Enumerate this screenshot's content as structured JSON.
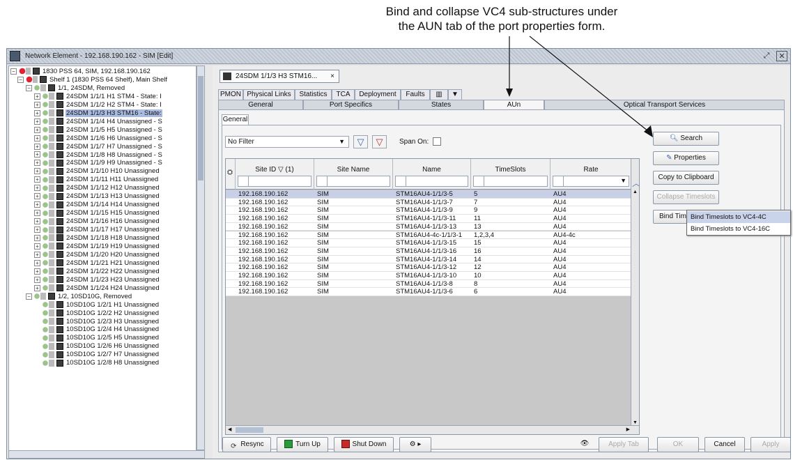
{
  "annotation": {
    "line1": "Bind and collapse VC4 sub-structures under",
    "line2": "the AUN tab of the port properties form."
  },
  "window": {
    "title": "Network Element - 192.168.190.162 - SIM [Edit]"
  },
  "tree": {
    "root": "1830 PSS 64, SIM, 192.168.190.162",
    "shelf": "Shelf 1 (1830 PSS 64 Shelf), Main Shelf",
    "card1": "1/1, 24SDM, Removed",
    "card1_ports": [
      "24SDM 1/1/1 H1 STM4 - State: I",
      "24SDM 1/1/2 H2 STM4 - State: I",
      "24SDM 1/1/3 H3 STM16 - State:",
      "24SDM 1/1/4 H4 Unassigned - S",
      "24SDM 1/1/5 H5 Unassigned - S",
      "24SDM 1/1/6 H6 Unassigned - S",
      "24SDM 1/1/7 H7 Unassigned - S",
      "24SDM 1/1/8 H8 Unassigned - S",
      "24SDM 1/1/9 H9 Unassigned - S",
      "24SDM 1/1/10 H10 Unassigned",
      "24SDM 1/1/11 H11 Unassigned",
      "24SDM 1/1/12 H12 Unassigned",
      "24SDM 1/1/13 H13 Unassigned",
      "24SDM 1/1/14 H14 Unassigned",
      "24SDM 1/1/15 H15 Unassigned",
      "24SDM 1/1/16 H16 Unassigned",
      "24SDM 1/1/17 H17 Unassigned",
      "24SDM 1/1/18 H18 Unassigned",
      "24SDM 1/1/19 H19 Unassigned",
      "24SDM 1/1/20 H20 Unassigned",
      "24SDM 1/1/21 H21 Unassigned",
      "24SDM 1/1/22 H22 Unassigned",
      "24SDM 1/1/23 H23 Unassigned",
      "24SDM 1/1/24 H24 Unassigned"
    ],
    "card2": "1/2, 10SD10G, Removed",
    "card2_ports": [
      "10SD10G 1/2/1 H1 Unassigned",
      "10SD10G 1/2/2 H2 Unassigned",
      "10SD10G 1/2/3 H3 Unassigned",
      "10SD10G 1/2/4 H4 Unassigned",
      "10SD10G 1/2/5 H5 Unassigned",
      "10SD10G 1/2/6 H6 Unassigned",
      "10SD10G 1/2/7 H7 Unassigned",
      "10SD10G 1/2/8 H8 Unassigned"
    ]
  },
  "doc_tab": "24SDM 1/1/3 H3 STM16...",
  "tabs_row1": [
    "PMON",
    "Physical Links",
    "Statistics",
    "TCA",
    "Deployment",
    "Faults"
  ],
  "tabs_row2": [
    "General",
    "Port Specifics",
    "States",
    "AUn",
    "Optical Transport Services"
  ],
  "sub_tab": "General",
  "filter": {
    "value": "No Filter",
    "span_label": "Span On:"
  },
  "table": {
    "columns": [
      "Site ID ▽ (1)",
      "Site Name",
      "Name",
      "TimeSlots",
      "Rate"
    ],
    "rows": [
      [
        "192.168.190.162",
        "SIM",
        "STM16AU4-1/1/3-5",
        "5",
        "AU4"
      ],
      [
        "192.168.190.162",
        "SIM",
        "STM16AU4-1/1/3-7",
        "7",
        "AU4"
      ],
      [
        "192.168.190.162",
        "SIM",
        "STM16AU4-1/1/3-9",
        "9",
        "AU4"
      ],
      [
        "192.168.190.162",
        "SIM",
        "STM16AU4-1/1/3-11",
        "11",
        "AU4"
      ],
      [
        "192.168.190.162",
        "SIM",
        "STM16AU4-1/1/3-13",
        "13",
        "AU4"
      ],
      [
        "192.168.190.162",
        "SIM",
        "STM16AU4-4c-1/1/3-1",
        "1,2,3,4",
        "AU4-4c"
      ],
      [
        "192.168.190.162",
        "SIM",
        "STM16AU4-1/1/3-15",
        "15",
        "AU4"
      ],
      [
        "192.168.190.162",
        "SIM",
        "STM16AU4-1/1/3-16",
        "16",
        "AU4"
      ],
      [
        "192.168.190.162",
        "SIM",
        "STM16AU4-1/1/3-14",
        "14",
        "AU4"
      ],
      [
        "192.168.190.162",
        "SIM",
        "STM16AU4-1/1/3-12",
        "12",
        "AU4"
      ],
      [
        "192.168.190.162",
        "SIM",
        "STM16AU4-1/1/3-10",
        "10",
        "AU4"
      ],
      [
        "192.168.190.162",
        "SIM",
        "STM16AU4-1/1/3-8",
        "8",
        "AU4"
      ],
      [
        "192.168.190.162",
        "SIM",
        "STM16AU4-1/1/3-6",
        "6",
        "AU4"
      ]
    ]
  },
  "side_buttons": {
    "search": "Search",
    "properties": "Properties",
    "copy": "Copy to Clipboard",
    "collapse": "Collapse Timeslots",
    "bind": "Bind Timesl"
  },
  "bind_menu": [
    "Bind Timeslots to VC4-4C",
    "Bind Timeslots to VC4-16C"
  ],
  "bottom": {
    "resync": "Resync",
    "turn_up": "Turn Up",
    "shut_down": "Shut Down",
    "apply_tab": "Apply Tab",
    "ok": "OK",
    "cancel": "Cancel",
    "apply": "Apply"
  }
}
